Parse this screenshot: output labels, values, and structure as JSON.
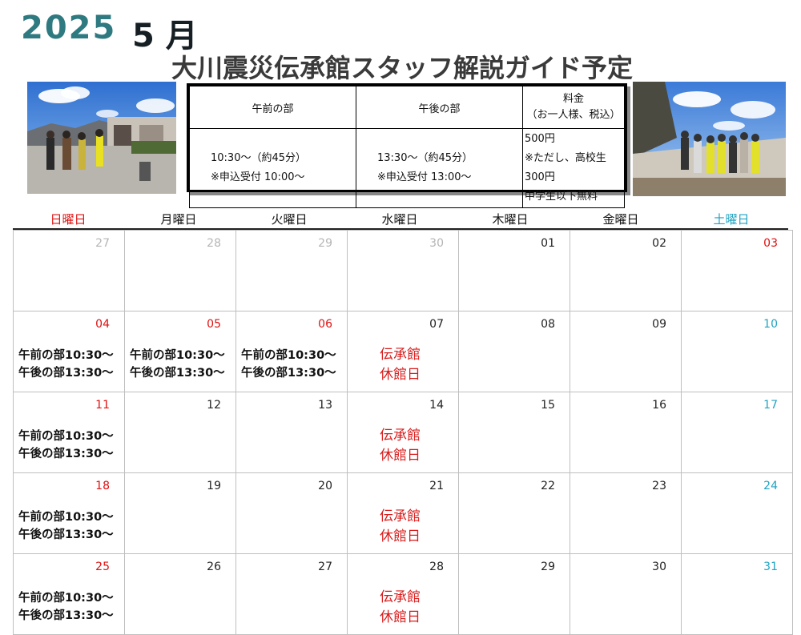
{
  "header": {
    "year": "2025",
    "month": "5 月",
    "title": "大川震災伝承館スタッフ解説ガイド予定"
  },
  "info_table": {
    "headers": [
      "午前の部",
      "午後の部",
      "料金\n（お一人様、税込）"
    ],
    "morning": [
      "10:30～（約45分）",
      "※申込受付 10:00～"
    ],
    "afternoon": [
      "13:30～（約45分）",
      "※申込受付 13:00～"
    ],
    "fee": [
      "500円",
      "※ただし、高校生300円",
      "中学生以下無料"
    ]
  },
  "weekdays": [
    "日曜日",
    "月曜日",
    "火曜日",
    "水曜日",
    "木曜日",
    "金曜日",
    "土曜日"
  ],
  "colors": {
    "sunday": "#e01010",
    "saturday": "#1fa3c2",
    "year": "#2e7a80",
    "closed": "#d81c1c"
  },
  "labels": {
    "morning_session": "午前の部10:30～",
    "afternoon_session": "午後の部13:30～",
    "closed_line1": "伝承館",
    "closed_line2": "休館日"
  },
  "weeks": [
    [
      {
        "day": "27",
        "type": "prev"
      },
      {
        "day": "28",
        "type": "prev"
      },
      {
        "day": "29",
        "type": "prev"
      },
      {
        "day": "30",
        "type": "prev"
      },
      {
        "day": "01",
        "type": "norm"
      },
      {
        "day": "02",
        "type": "norm"
      },
      {
        "day": "03",
        "type": "sun"
      }
    ],
    [
      {
        "day": "04",
        "type": "sun",
        "guide": true
      },
      {
        "day": "05",
        "type": "sun",
        "guide": true
      },
      {
        "day": "06",
        "type": "sun",
        "guide": true
      },
      {
        "day": "07",
        "type": "norm",
        "closed": true
      },
      {
        "day": "08",
        "type": "norm"
      },
      {
        "day": "09",
        "type": "norm"
      },
      {
        "day": "10",
        "type": "sat"
      }
    ],
    [
      {
        "day": "11",
        "type": "sun",
        "guide": true
      },
      {
        "day": "12",
        "type": "norm"
      },
      {
        "day": "13",
        "type": "norm"
      },
      {
        "day": "14",
        "type": "norm",
        "closed": true
      },
      {
        "day": "15",
        "type": "norm"
      },
      {
        "day": "16",
        "type": "norm"
      },
      {
        "day": "17",
        "type": "sat"
      }
    ],
    [
      {
        "day": "18",
        "type": "sun",
        "guide": true
      },
      {
        "day": "19",
        "type": "norm"
      },
      {
        "day": "20",
        "type": "norm"
      },
      {
        "day": "21",
        "type": "norm",
        "closed": true
      },
      {
        "day": "22",
        "type": "norm"
      },
      {
        "day": "23",
        "type": "norm"
      },
      {
        "day": "24",
        "type": "sat"
      }
    ],
    [
      {
        "day": "25",
        "type": "sun",
        "guide": true
      },
      {
        "day": "26",
        "type": "norm"
      },
      {
        "day": "27",
        "type": "norm"
      },
      {
        "day": "28",
        "type": "norm",
        "closed": true
      },
      {
        "day": "29",
        "type": "norm"
      },
      {
        "day": "30",
        "type": "norm"
      },
      {
        "day": "31",
        "type": "sat"
      }
    ]
  ]
}
